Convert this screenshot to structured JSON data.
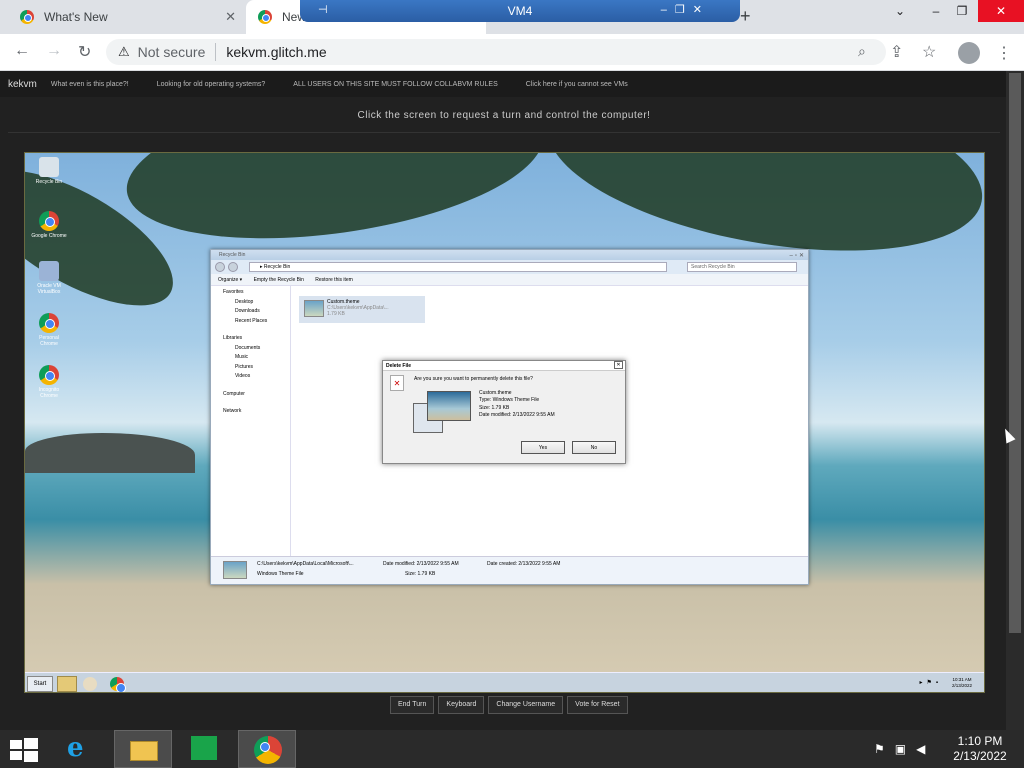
{
  "browser": {
    "tabs": [
      {
        "label": "What's New",
        "close": "✕"
      },
      {
        "label": "New Tab",
        "close": "✕"
      }
    ],
    "vm_window_title": "VM4",
    "new_tab": "+",
    "address": {
      "security": "Not secure",
      "url": "kekvm.glitch.me"
    }
  },
  "site": {
    "brand": "kekvm",
    "nav": [
      "What even is this place?!",
      "Looking for old operating systems?",
      "ALL USERS ON THIS SITE MUST FOLLOW COLLABVM RULES",
      "Click here if you cannot see VMs"
    ],
    "instruction": "Click the screen to request a turn and control the computer!",
    "vm_buttons": [
      "End Turn",
      "Keyboard",
      "Change Username",
      "Vote for Reset"
    ]
  },
  "guest": {
    "desktop_icons": [
      "Recycle Bin",
      "Google Chrome",
      "Oracle VM VirtualBox",
      "Personal Chrome",
      "Incognito Chrome"
    ],
    "explorer": {
      "title": "Recycle Bin",
      "path": "▸ Recycle Bin",
      "search_placeholder": "Search Recycle Bin",
      "commands": [
        "Organize ▾",
        "Empty the Recycle Bin",
        "Restore this item"
      ],
      "nav": {
        "favorites": "Favorites",
        "favorites_items": [
          "Desktop",
          "Downloads",
          "Recent Places"
        ],
        "libraries": "Libraries",
        "libraries_items": [
          "Documents",
          "Music",
          "Pictures",
          "Videos"
        ],
        "computer": "Computer",
        "network": "Network"
      },
      "file": {
        "name": "Custom.theme",
        "path": "C:\\Users\\kekvm\\AppData\\...",
        "size": "1.79 KB"
      },
      "details": {
        "path": "C:\\Users\\kekvm\\AppData\\Local\\Microsoft\\...",
        "type": "Windows Theme File",
        "modified": "Date modified: 2/13/2022 9:55 AM",
        "created": "Date created: 2/13/2022 9:55 AM",
        "size": "Size: 1.79 KB"
      }
    },
    "dialog": {
      "title": "Delete File",
      "question": "Are you sure you want to permanently delete this file?",
      "name": "Custom.theme",
      "type": "Type: Windows Theme File",
      "size": "Size: 1.79 KB",
      "modified": "Date modified: 2/13/2022 9:55 AM",
      "yes": "Yes",
      "no": "No"
    },
    "taskbar": {
      "start": "Start",
      "time": "10:31 AM",
      "date": "2/13/2022"
    }
  },
  "host": {
    "time": "1:10 PM",
    "date": "2/13/2022"
  }
}
